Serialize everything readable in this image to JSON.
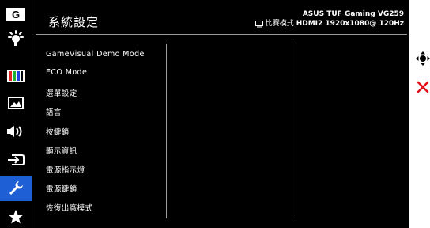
{
  "sidebar": {
    "items": [
      {
        "name": "gamevisual",
        "icon": "g-icon",
        "label": "G"
      },
      {
        "name": "blue-light-filter",
        "icon": "bulb-icon"
      },
      {
        "name": "color",
        "icon": "color-bars-icon"
      },
      {
        "name": "image",
        "icon": "image-icon"
      },
      {
        "name": "sound",
        "icon": "speaker-icon"
      },
      {
        "name": "input-select",
        "icon": "input-icon"
      },
      {
        "name": "system-setup",
        "icon": "wrench-icon",
        "active": true
      },
      {
        "name": "myfavorite",
        "icon": "star-icon"
      }
    ]
  },
  "header": {
    "title": "系統設定",
    "model": "ASUS TUF Gaming  VG259",
    "mode_label": "比賽模式",
    "signal": "HDMI2 1920x1080@ 120Hz"
  },
  "menu": {
    "items": [
      "GameVisual Demo Mode",
      "ECO Mode",
      "選單設定",
      "語言",
      "按鍵鎖",
      "顯示資訊",
      "電源指示燈",
      "電源鍵鎖",
      "恢復出廠模式"
    ]
  },
  "nav": {
    "icons": [
      "joystick-icon",
      "close-icon"
    ],
    "close_color": "#e0141e"
  },
  "colors": {
    "accent": "#1f5fd6",
    "panel": "#000000"
  }
}
